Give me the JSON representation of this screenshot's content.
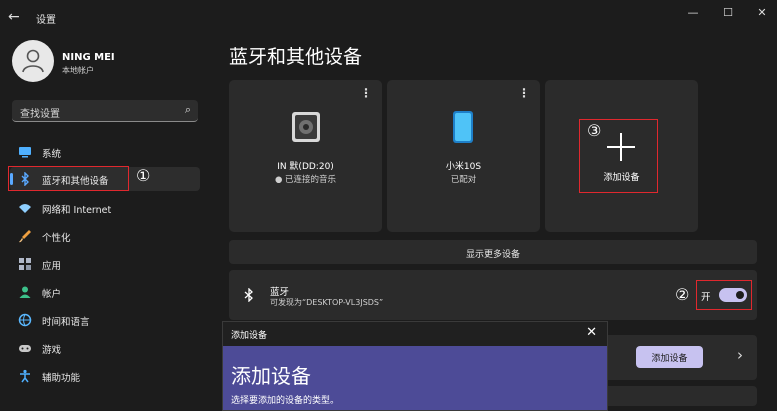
{
  "window": {
    "title": "设置",
    "back_glyph": "←",
    "minimize_glyph": "—",
    "maximize_glyph": "☐",
    "close_glyph": "✕"
  },
  "user": {
    "name": "NING MEI",
    "account_type": "本地帐户"
  },
  "search": {
    "placeholder": "查找设置",
    "icon": "search-icon"
  },
  "sidebar": {
    "items": [
      {
        "label": "系统",
        "icon": "system-icon",
        "color": "#4fb0ff"
      },
      {
        "label": "蓝牙和其他设备",
        "icon": "bluetooth-icon",
        "color": "#5aa9ff"
      },
      {
        "label": "网络和 Internet",
        "icon": "wifi-icon",
        "color": "#8fd0ff"
      },
      {
        "label": "个性化",
        "icon": "brush-icon",
        "color": "#f0a040"
      },
      {
        "label": "应用",
        "icon": "apps-icon",
        "color": "#b0b8c8"
      },
      {
        "label": "帐户",
        "icon": "account-icon",
        "color": "#3cc08a"
      },
      {
        "label": "时间和语言",
        "icon": "globe-icon",
        "color": "#5ab8ff"
      },
      {
        "label": "游戏",
        "icon": "game-icon",
        "color": "#c8c8c8"
      },
      {
        "label": "辅助功能",
        "icon": "accessibility-icon",
        "color": "#4fb0ff"
      }
    ],
    "selected_index": 1
  },
  "annotations": {
    "one": "①",
    "two": "②",
    "three": "③",
    "highlight_color": "#e0282e"
  },
  "main": {
    "title": "蓝牙和其他设备",
    "devices": [
      {
        "name": "IN 默(DD:20)",
        "status": "● 已连接的音乐",
        "icon": "speaker-icon",
        "menu": "⋮"
      },
      {
        "name": "小米10S",
        "status": "已配对",
        "icon": "phone-icon",
        "menu": "⋮"
      }
    ],
    "add_card_label": "添加设备",
    "show_more": "显示更多设备",
    "bluetooth": {
      "title": "蓝牙",
      "subtitle": "可发现为“DESKTOP-VL3JSDS”",
      "state_label": "开",
      "enabled": true
    },
    "add_device_button": "添加设备",
    "chevron": "›"
  },
  "dialog": {
    "title": "添加设备",
    "close": "✕",
    "heading": "添加设备",
    "subtitle": "选择要添加的设备的类型。"
  },
  "colors": {
    "accent": "#c7c2f0",
    "dialog_body": "#4d4b97",
    "background": "#1c1c1c",
    "card": "#2b2b2b"
  }
}
